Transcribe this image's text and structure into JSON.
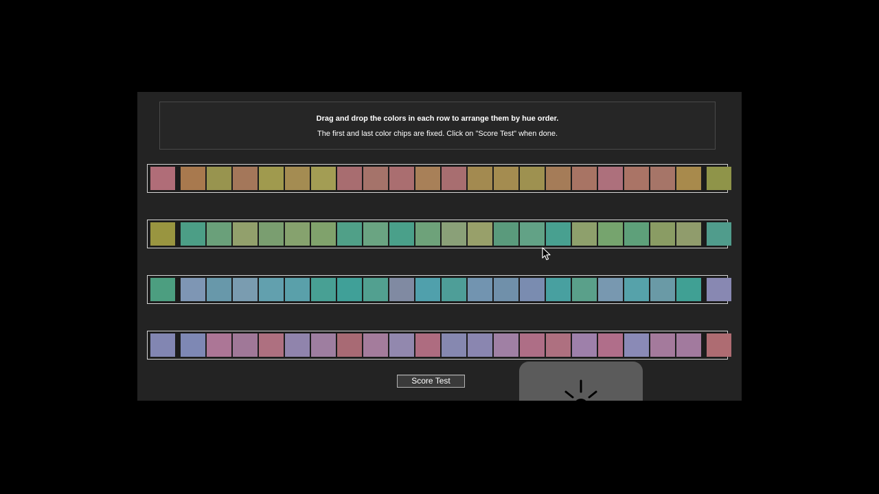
{
  "instructions": {
    "line1": "Drag and drop the colors in each row to arrange them by hue order.",
    "line2": "The first and last color chips are fixed. Click on \"Score Test\" when done."
  },
  "rows": [
    {
      "chips": [
        "#b06d78",
        "#a8794e",
        "#98944f",
        "#a4775a",
        "#a09a4e",
        "#a48c52",
        "#a39d54",
        "#a86d70",
        "#a5736a",
        "#aa6e70",
        "#a88058",
        "#a86e70",
        "#a38a50",
        "#a48c50",
        "#9e9150",
        "#a57c58",
        "#a87464",
        "#ad707c",
        "#aa7466",
        "#a67568",
        "#a88a4c",
        "#8f9449"
      ]
    },
    {
      "chips": [
        "#999540",
        "#4c9e86",
        "#6aa07a",
        "#92a06c",
        "#7a9e70",
        "#86a26e",
        "#80a26c",
        "#50a088",
        "#6aa482",
        "#4aa08a",
        "#6ea27a",
        "#8aa078",
        "#98a06a",
        "#5a9a7c",
        "#62a286",
        "#48a090",
        "#8ea06c",
        "#76a46e",
        "#5ea07a",
        "#8a9c64",
        "#909c6c",
        "#509c8c"
      ]
    },
    {
      "chips": [
        "#4c9e80",
        "#7e96b4",
        "#6898aa",
        "#7a9cb0",
        "#62a0ae",
        "#5aa0aa",
        "#48a094",
        "#40a098",
        "#52a090",
        "#808aa2",
        "#50a0ac",
        "#4e9e98",
        "#7294b0",
        "#7090aa",
        "#7a8cb0",
        "#48a0a0",
        "#5aa08a",
        "#7898b0",
        "#56a2aa",
        "#6a9aa6",
        "#40a094",
        "#8888b2"
      ]
    },
    {
      "chips": [
        "#8286b2",
        "#7e88b4",
        "#ac7696",
        "#a07898",
        "#ae7080",
        "#9084ac",
        "#9e7ea0",
        "#a86a74",
        "#a47c9c",
        "#9288ae",
        "#ae6c80",
        "#8688b0",
        "#8a86b0",
        "#a080a4",
        "#ae6e86",
        "#ae7080",
        "#9e80aa",
        "#b06e8a",
        "#8a8ab6",
        "#a47a9c",
        "#a27a9e",
        "#ae6c72"
      ]
    }
  ],
  "score_button": {
    "label": "Score Test"
  },
  "icons": {
    "loading": "spinner-icon",
    "pointer": "cursor-icon"
  },
  "colors": {
    "page_background": "#000000",
    "panel_background": "#232323",
    "row_border": "#d8d8d8",
    "text": "#ffffff",
    "overlay": "#5b5b5b"
  }
}
